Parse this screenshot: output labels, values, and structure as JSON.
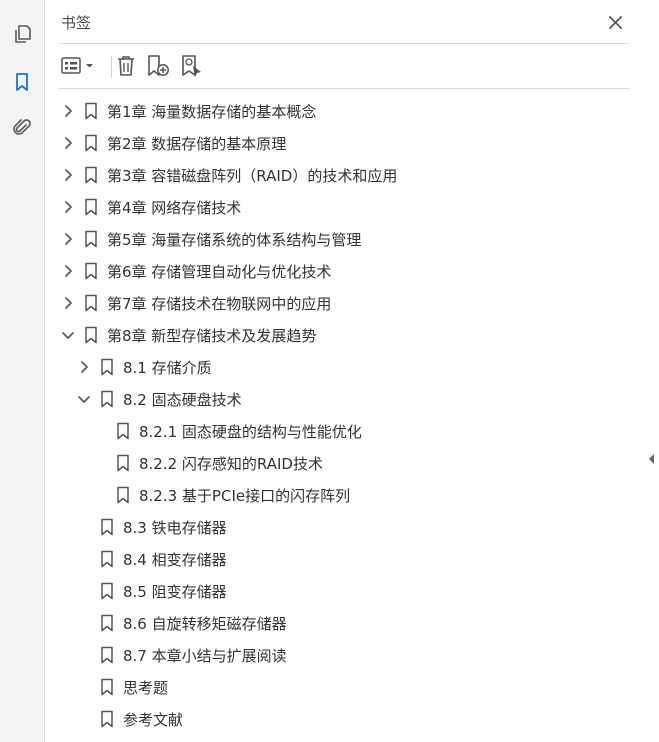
{
  "panel": {
    "title": "书签",
    "close_glyph": "✕"
  },
  "rail": {
    "items": [
      {
        "name": "pages-icon",
        "active": false
      },
      {
        "name": "bookmark-icon",
        "active": true
      },
      {
        "name": "attachment-icon",
        "active": false
      }
    ]
  },
  "toolbar": {
    "buttons": [
      "options-menu",
      "delete-bookmark",
      "new-bookmark",
      "new-bookmark-from-structure"
    ]
  },
  "bookmarks": [
    {
      "level": 0,
      "state": "collapsed",
      "label": "第1章 海量数据存储的基本概念"
    },
    {
      "level": 0,
      "state": "collapsed",
      "label": "第2章 数据存储的基本原理"
    },
    {
      "level": 0,
      "state": "collapsed",
      "label": "第3章 容错磁盘阵列（RAID）的技术和应用"
    },
    {
      "level": 0,
      "state": "collapsed",
      "label": "第4章 网络存储技术"
    },
    {
      "level": 0,
      "state": "collapsed",
      "label": "第5章 海量存储系统的体系结构与管理"
    },
    {
      "level": 0,
      "state": "collapsed",
      "label": "第6章 存储管理自动化与优化技术"
    },
    {
      "level": 0,
      "state": "collapsed",
      "label": "第7章 存储技术在物联网中的应用"
    },
    {
      "level": 0,
      "state": "expanded",
      "label": "第8章 新型存储技术及发展趋势"
    },
    {
      "level": 1,
      "state": "collapsed",
      "label": "8.1 存储介质"
    },
    {
      "level": 1,
      "state": "expanded",
      "label": "8.2 固态硬盘技术"
    },
    {
      "level": 2,
      "state": "leaf",
      "label": "8.2.1 固态硬盘的结构与性能优化"
    },
    {
      "level": 2,
      "state": "leaf",
      "label": "8.2.2 闪存感知的RAID技术"
    },
    {
      "level": 2,
      "state": "leaf",
      "label": "8.2.3 基于PCIe接口的闪存阵列"
    },
    {
      "level": 1,
      "state": "leaf",
      "label": "8.3 铁电存储器"
    },
    {
      "level": 1,
      "state": "leaf",
      "label": "8.4 相变存储器"
    },
    {
      "level": 1,
      "state": "leaf",
      "label": "8.5 阻变存储器"
    },
    {
      "level": 1,
      "state": "leaf",
      "label": "8.6 自旋转移矩磁存储器"
    },
    {
      "level": 1,
      "state": "leaf",
      "label": "8.7 本章小结与扩展阅读"
    },
    {
      "level": 1,
      "state": "leaf",
      "label": "思考题"
    },
    {
      "level": 1,
      "state": "leaf",
      "label": "参考文献"
    }
  ],
  "colors": {
    "accent": "#1473e6",
    "icon": "#5a5a5a",
    "text": "#333333",
    "rail_bg": "#f4f4f4"
  }
}
